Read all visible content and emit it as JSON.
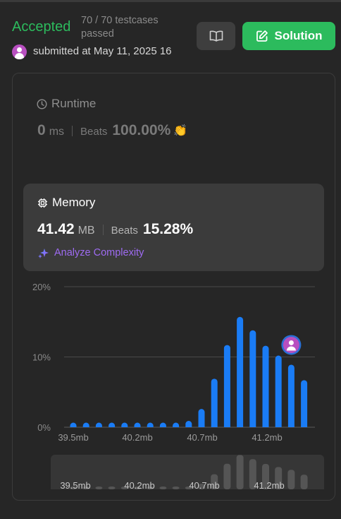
{
  "result": {
    "status": "Accepted",
    "testcases": "70 / 70 testcases passed",
    "submitted": "submitted at May 11, 2025 16"
  },
  "actions": {
    "book_icon": "book-open-icon",
    "solution_label": "Solution",
    "solution_icon": "edit-square-icon"
  },
  "colors": {
    "accent_green": "#2cbb5d",
    "bar_blue": "#1a7cf5",
    "purple": "#9e6bf2",
    "avatar": "#b84fc0"
  },
  "runtime": {
    "title": "Runtime",
    "value": "0",
    "unit": "ms",
    "beats_label": "Beats",
    "beats_value": "100.00%"
  },
  "memory": {
    "title": "Memory",
    "value": "41.42",
    "unit": "MB",
    "beats_label": "Beats",
    "beats_value": "15.28%",
    "analyze_label": "Analyze Complexity"
  },
  "chart_data": {
    "type": "bar",
    "ylim": [
      0,
      20
    ],
    "yticks": [
      "20%",
      "10%",
      "0%"
    ],
    "xticks": [
      "39.5mb",
      "40.2mb",
      "40.7mb",
      "41.2mb"
    ],
    "values": [
      0.4,
      0.4,
      0.4,
      0.4,
      0.4,
      0.4,
      0.4,
      0.4,
      0.4,
      0.9,
      2.6,
      6.9,
      11.7,
      15.7,
      13.8,
      11.6,
      10.2,
      8.9,
      6.7
    ],
    "highlight_index": 17,
    "grid": true
  },
  "mini_chart": {
    "xticks": [
      "39.5mb",
      "40.2mb",
      "40.7mb",
      "41.2mb"
    ]
  }
}
